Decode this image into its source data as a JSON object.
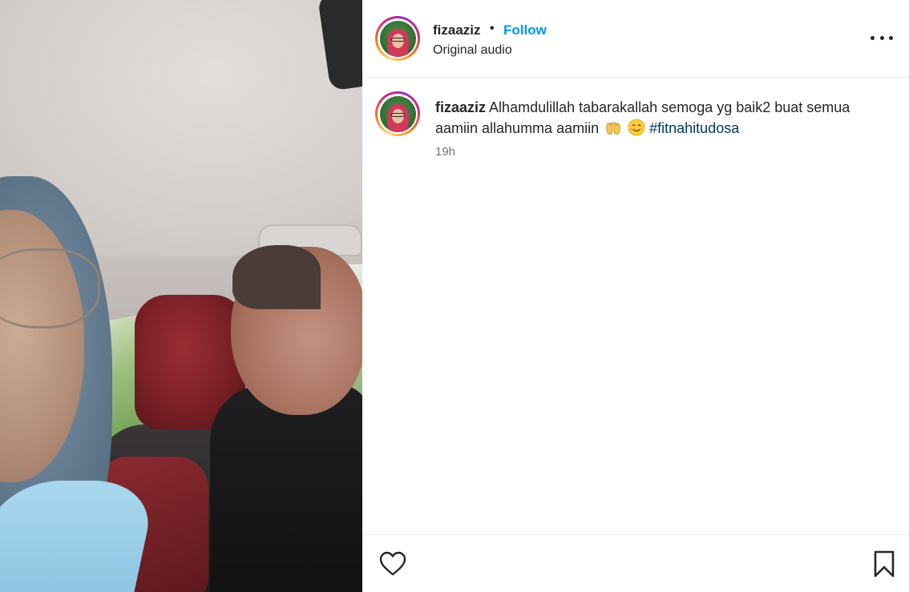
{
  "post": {
    "username": "fizaaziz",
    "separator": "•",
    "follow_label": "Follow",
    "audio_label": "Original audio",
    "more_icon": "more-horizontal-icon"
  },
  "caption": {
    "username": "fizaaziz",
    "text": "Alhamdulillah tabarakallah semoga yg baik2 buat semua aamiin allahumma aamiin",
    "emojis": [
      "open-hands-emoji",
      "smiling-face-emoji"
    ],
    "hashtag": "#fitnahitudosa",
    "time": "19h"
  },
  "actions": {
    "like_icon": "heart-icon",
    "save_icon": "bookmark-icon"
  },
  "colors": {
    "link_blue": "#0095f6",
    "hashtag": "#00376b",
    "muted": "#737373",
    "text": "#262626"
  }
}
